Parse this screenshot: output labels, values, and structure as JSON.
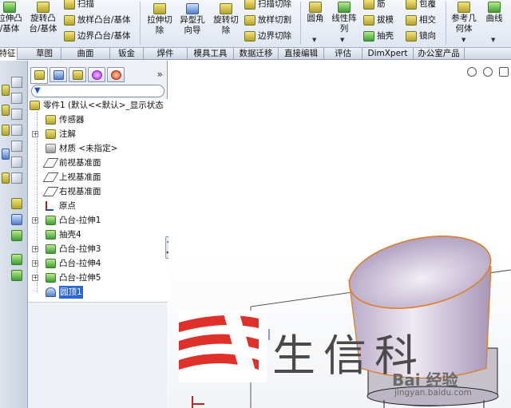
{
  "ribbon": {
    "partial_left_label": "拉伸凸\n/基体",
    "revolve_boss": "旋转凸\n台/基体",
    "sweep": "扫描",
    "loft_boss": "放样凸台/基体",
    "boundary_boss": "边界凸台/基体",
    "extruded_cut": "拉伸切\n除",
    "hole_wizard": "异型孔\n向导",
    "revolved_cut": "旋转切\n除",
    "swept_cut": "扫描切除",
    "lofted_cut": "放样切割",
    "boundary_cut": "边界切除",
    "fillet": "圆角",
    "linear_pattern": "线性阵\n列",
    "rib": "筋",
    "draft": "拔模",
    "shell": "抽壳",
    "wrap": "包覆",
    "intersect": "相交",
    "mirror": "镜向",
    "ref_geometry": "参考几\n何体",
    "curves": "曲线"
  },
  "tabs": [
    "特征",
    "草图",
    "曲面",
    "钣金",
    "焊件",
    "模具工具",
    "数据迁移",
    "直接编辑",
    "评估",
    "DimXpert",
    "办公室产品"
  ],
  "panel": {
    "expand_symbol": "»",
    "filter_symbol": "▼"
  },
  "tree": {
    "root": "零件1 (默认<<默认>_显示状态",
    "items": [
      {
        "label": "传感器",
        "expand": ""
      },
      {
        "label": "注解",
        "expand": "+"
      },
      {
        "label": "材质 <未指定>",
        "expand": ""
      },
      {
        "label": "前视基准面",
        "expand": ""
      },
      {
        "label": "上视基准面",
        "expand": ""
      },
      {
        "label": "右视基准面",
        "expand": ""
      },
      {
        "label": "原点",
        "expand": ""
      },
      {
        "label": "凸台-拉伸1",
        "expand": "+"
      },
      {
        "label": "抽壳4",
        "expand": ""
      },
      {
        "label": "凸台-拉伸3",
        "expand": "+"
      },
      {
        "label": "凸台-拉伸4",
        "expand": "+"
      },
      {
        "label": "凸台-拉伸5",
        "expand": "+"
      },
      {
        "label": "圆顶1",
        "expand": ""
      }
    ]
  },
  "watermark": {
    "text": "生信科",
    "baidu": "Bai 经验",
    "url": "jingyan.baidu.com"
  },
  "colors": {
    "selection": "#2a66d6",
    "watermark_red": "#e0302a",
    "model_fill": "#c9bdd4",
    "model_edge": "#e07b1e"
  }
}
